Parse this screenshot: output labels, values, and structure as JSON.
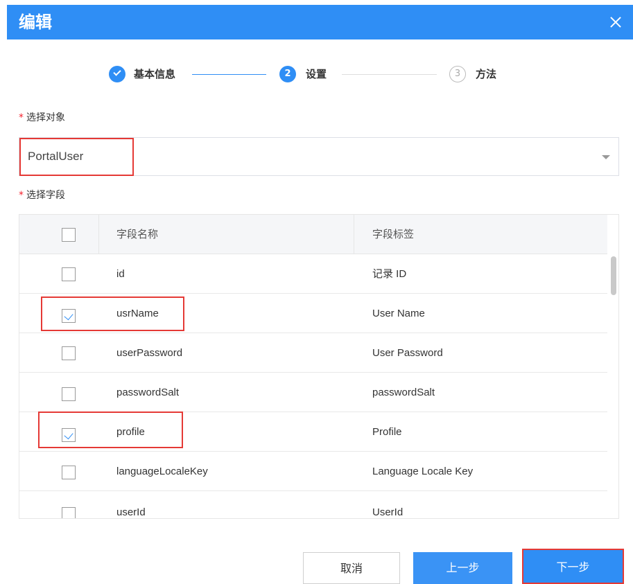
{
  "dialog": {
    "title": "编辑"
  },
  "steps": [
    {
      "number": "",
      "label": "基本信息",
      "status": "done"
    },
    {
      "number": "2",
      "label": "设置",
      "status": "active"
    },
    {
      "number": "3",
      "label": "方法",
      "status": "pending"
    }
  ],
  "object_field": {
    "label": "选择对象",
    "required_mark": "*",
    "value": "PortalUser"
  },
  "fields_field": {
    "label": "选择字段",
    "required_mark": "*"
  },
  "table": {
    "headers": {
      "name": "字段名称",
      "label": "字段标签"
    },
    "rows": [
      {
        "name": "id",
        "label": "记录 ID",
        "checked": false
      },
      {
        "name": "usrName",
        "label": "User Name",
        "checked": true
      },
      {
        "name": "userPassword",
        "label": "User Password",
        "checked": false
      },
      {
        "name": "passwordSalt",
        "label": "passwordSalt",
        "checked": false
      },
      {
        "name": "profile",
        "label": "Profile",
        "checked": true
      },
      {
        "name": "languageLocaleKey",
        "label": "Language Locale Key",
        "checked": false
      },
      {
        "name": "userId",
        "label": "UserId",
        "checked": false
      }
    ]
  },
  "footer": {
    "cancel_label": "取消",
    "prev_label": "上一步",
    "next_label": "下一步"
  },
  "colors": {
    "primary": "#2f8ef5",
    "highlight": "#e53935",
    "required": "#f5222d"
  }
}
